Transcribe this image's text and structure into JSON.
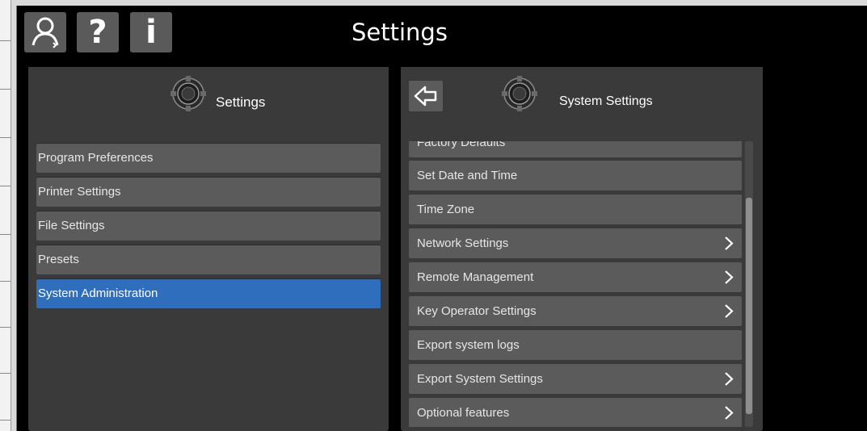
{
  "window": {
    "title": "Settings"
  },
  "toolbar": {
    "user_icon": "user-icon",
    "help_label": "?",
    "info_label": "i"
  },
  "left_panel": {
    "header_label": "Settings",
    "items": [
      {
        "label": "Program Preferences"
      },
      {
        "label": "Printer Settings"
      },
      {
        "label": "File Settings"
      },
      {
        "label": "Presets"
      },
      {
        "label": "System Administration",
        "selected": true
      }
    ]
  },
  "right_panel": {
    "header_label": "System Settings",
    "items": [
      {
        "label": "Factory Defaults",
        "chevron": false
      },
      {
        "label": "Set Date and Time",
        "chevron": false
      },
      {
        "label": "Time Zone",
        "chevron": false
      },
      {
        "label": "Network Settings",
        "chevron": true
      },
      {
        "label": "Remote Management",
        "chevron": true
      },
      {
        "label": "Key Operator Settings",
        "chevron": true
      },
      {
        "label": "Export system logs",
        "chevron": false
      },
      {
        "label": "Export System Settings",
        "chevron": true
      },
      {
        "label": "Optional features",
        "chevron": true
      }
    ]
  },
  "colors": {
    "background": "#000000",
    "panel": "#3a3a3a",
    "item": "#5b5b5b",
    "selected": "#2f6ebc",
    "text": "#e6e6e6"
  }
}
